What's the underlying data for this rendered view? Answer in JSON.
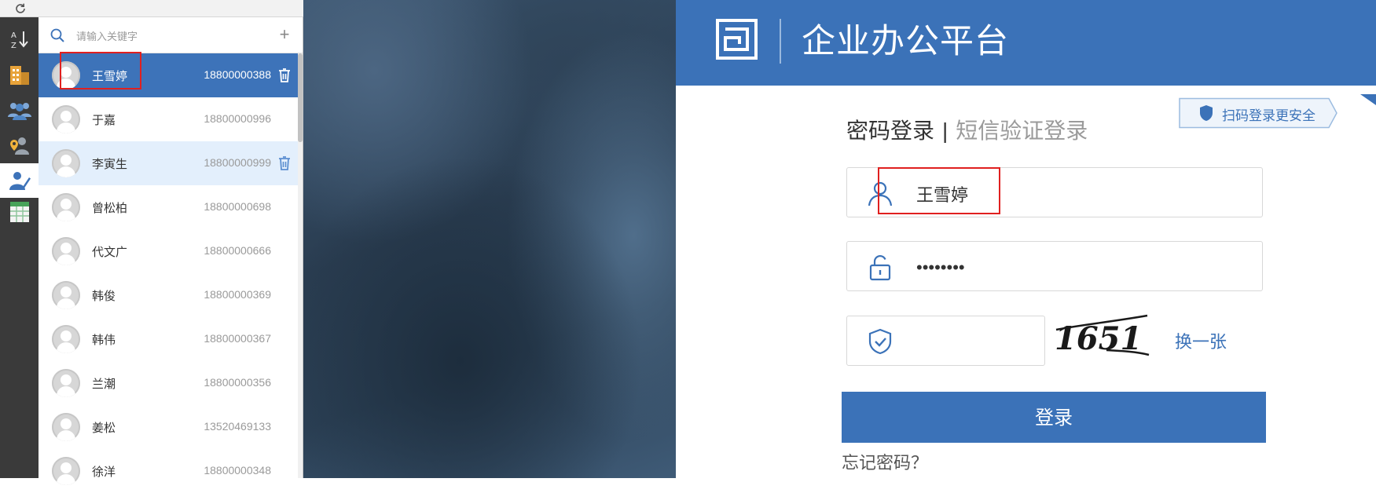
{
  "contacts_panel": {
    "search": {
      "placeholder": "请输入关键字"
    },
    "add_label": "+",
    "items": [
      {
        "name": "王雪婷",
        "phone": "18800000388",
        "state": "selected",
        "trash": true
      },
      {
        "name": "于嘉",
        "phone": "18800000996",
        "state": "normal",
        "trash": false
      },
      {
        "name": "李寅生",
        "phone": "18800000999",
        "state": "hover",
        "trash": true
      },
      {
        "name": "曾松柏",
        "phone": "18800000698",
        "state": "normal",
        "trash": false
      },
      {
        "name": "代文广",
        "phone": "18800000666",
        "state": "normal",
        "trash": false
      },
      {
        "name": "韩俊",
        "phone": "18800000369",
        "state": "normal",
        "trash": false
      },
      {
        "name": "韩伟",
        "phone": "18800000367",
        "state": "normal",
        "trash": false
      },
      {
        "name": "兰潮",
        "phone": "18800000356",
        "state": "normal",
        "trash": false
      },
      {
        "name": "姜松",
        "phone": "13520469133",
        "state": "normal",
        "trash": false
      },
      {
        "name": "徐洋",
        "phone": "18800000348",
        "state": "normal",
        "trash": false
      }
    ]
  },
  "rail": {
    "icons": [
      "sort-az-icon",
      "buildings-icon",
      "group-icon",
      "user-location-icon",
      "user-edit-icon",
      "spreadsheet-icon"
    ],
    "active_icon": "user-edit-icon"
  },
  "login": {
    "header_title": "企业办公平台",
    "qr_badge": "扫码登录更安全",
    "tab_password": "密码登录",
    "tab_separator": "|",
    "tab_sms": "短信验证登录",
    "username_value": "王雪婷",
    "password_value": "********",
    "captcha_value": "",
    "captcha_text": "1651",
    "refresh_captcha": "换一张",
    "login_button": "登录",
    "forgot_password": "忘记密码？"
  },
  "colors": {
    "brand_blue": "#3b72b8",
    "selection_blue": "#3d73b9",
    "hover_blue": "#e3effc",
    "highlight_red": "#e0201f",
    "rail_dark": "#3a3a3a"
  }
}
